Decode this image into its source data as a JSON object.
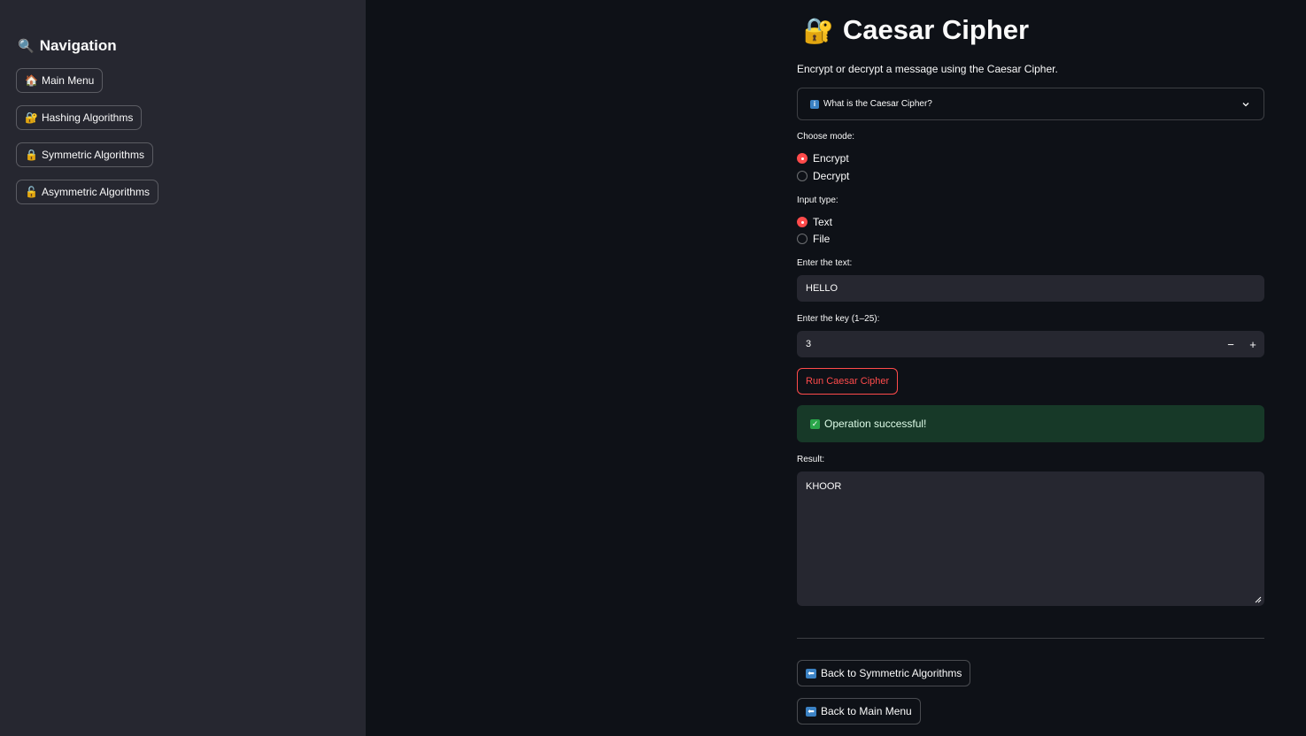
{
  "sidebar": {
    "title": "Navigation",
    "title_icon": "magnifier-icon",
    "items": [
      {
        "label": "Main Menu",
        "icon": "house-icon"
      },
      {
        "label": "Hashing Algorithms",
        "icon": "gift-lock-icon"
      },
      {
        "label": "Symmetric Algorithms",
        "icon": "lock-icon"
      },
      {
        "label": "Asymmetric Algorithms",
        "icon": "unlock-icon"
      }
    ]
  },
  "main": {
    "title": "Caesar Cipher",
    "title_icon": "lock-with-key-icon",
    "caption": "Encrypt or decrypt a message using the Caesar Cipher.",
    "expander_label": "What is the Caesar Cipher?",
    "mode": {
      "label": "Choose mode:",
      "options": [
        "Encrypt",
        "Decrypt"
      ],
      "selected": "Encrypt"
    },
    "input_type": {
      "label": "Input type:",
      "options": [
        "Text",
        "File"
      ],
      "selected": "Text"
    },
    "text_input": {
      "label": "Enter the text:",
      "value": "HELLO"
    },
    "key_input": {
      "label": "Enter the key (1–25):",
      "value": "3",
      "minus": "−",
      "plus": "+"
    },
    "run_button": "Run Caesar Cipher",
    "success_message": "Operation successful!",
    "result": {
      "label": "Result:",
      "value": "KHOOR"
    },
    "back_symmetric": "Back to Symmetric Algorithms",
    "back_main": "Back to Main Menu"
  },
  "colors": {
    "background": "#0e1117",
    "sidebar": "#262730",
    "accent": "#ff4b4b",
    "success_bg": "#173928"
  }
}
